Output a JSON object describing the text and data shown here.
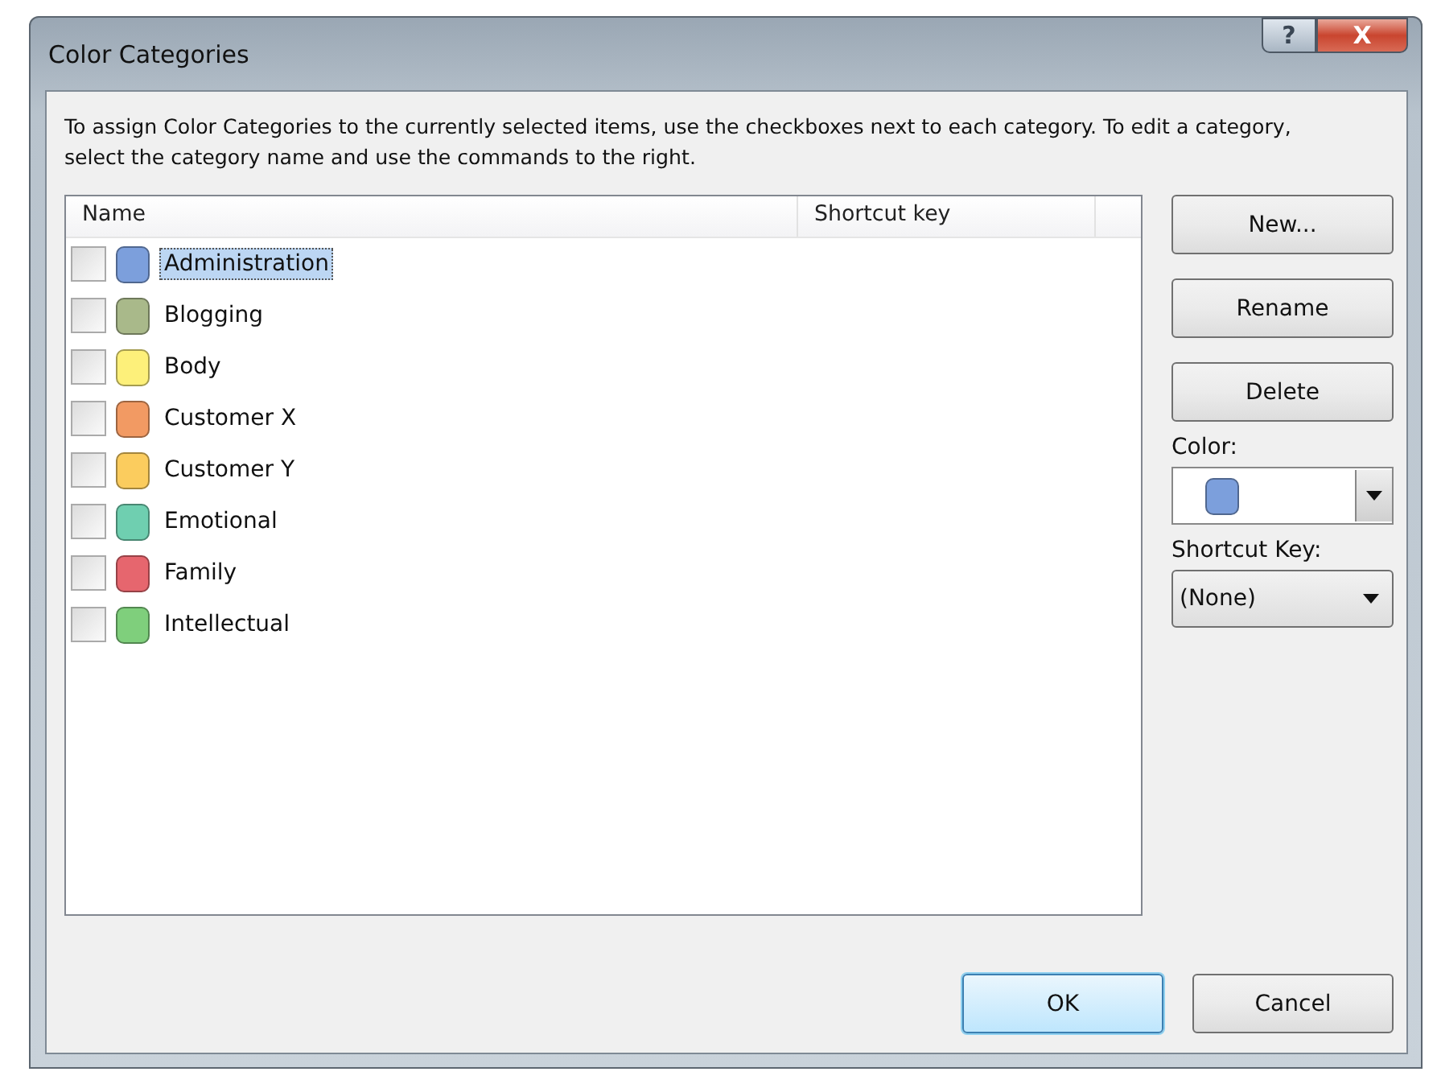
{
  "window": {
    "title": "Color Categories",
    "title_buttons": [
      {
        "kind": "help",
        "label": "?"
      },
      {
        "kind": "close",
        "label": "X"
      }
    ]
  },
  "instructions": "To assign Color Categories to the currently selected items, use the checkboxes next to each category.  To edit a category, select the category name and use the commands to the right.",
  "list": {
    "columns": [
      "Name",
      "Shortcut key"
    ],
    "rows": [
      {
        "name": "Administration",
        "color": "#7c9fdc",
        "checked": false,
        "selected": true
      },
      {
        "name": "Blogging",
        "color": "#a9b98a",
        "checked": false,
        "selected": false
      },
      {
        "name": "Body",
        "color": "#fdf07a",
        "checked": false,
        "selected": false
      },
      {
        "name": "Customer X",
        "color": "#f29a63",
        "checked": false,
        "selected": false
      },
      {
        "name": "Customer Y",
        "color": "#fbcc5e",
        "checked": false,
        "selected": false
      },
      {
        "name": "Emotional",
        "color": "#6fcfb0",
        "checked": false,
        "selected": false
      },
      {
        "name": "Family",
        "color": "#e6666e",
        "checked": false,
        "selected": false
      },
      {
        "name": "Intellectual",
        "color": "#7fcf7c",
        "checked": false,
        "selected": false
      }
    ]
  },
  "commands": [
    "New...",
    "Rename",
    "Delete"
  ],
  "color_field": {
    "label": "Color:",
    "color": "#7c9fdc"
  },
  "shortcut_field": {
    "label": "Shortcut Key:",
    "value": "(None)"
  },
  "buttons": [
    {
      "label": "OK",
      "default": true
    },
    {
      "label": "Cancel",
      "default": false
    }
  ]
}
